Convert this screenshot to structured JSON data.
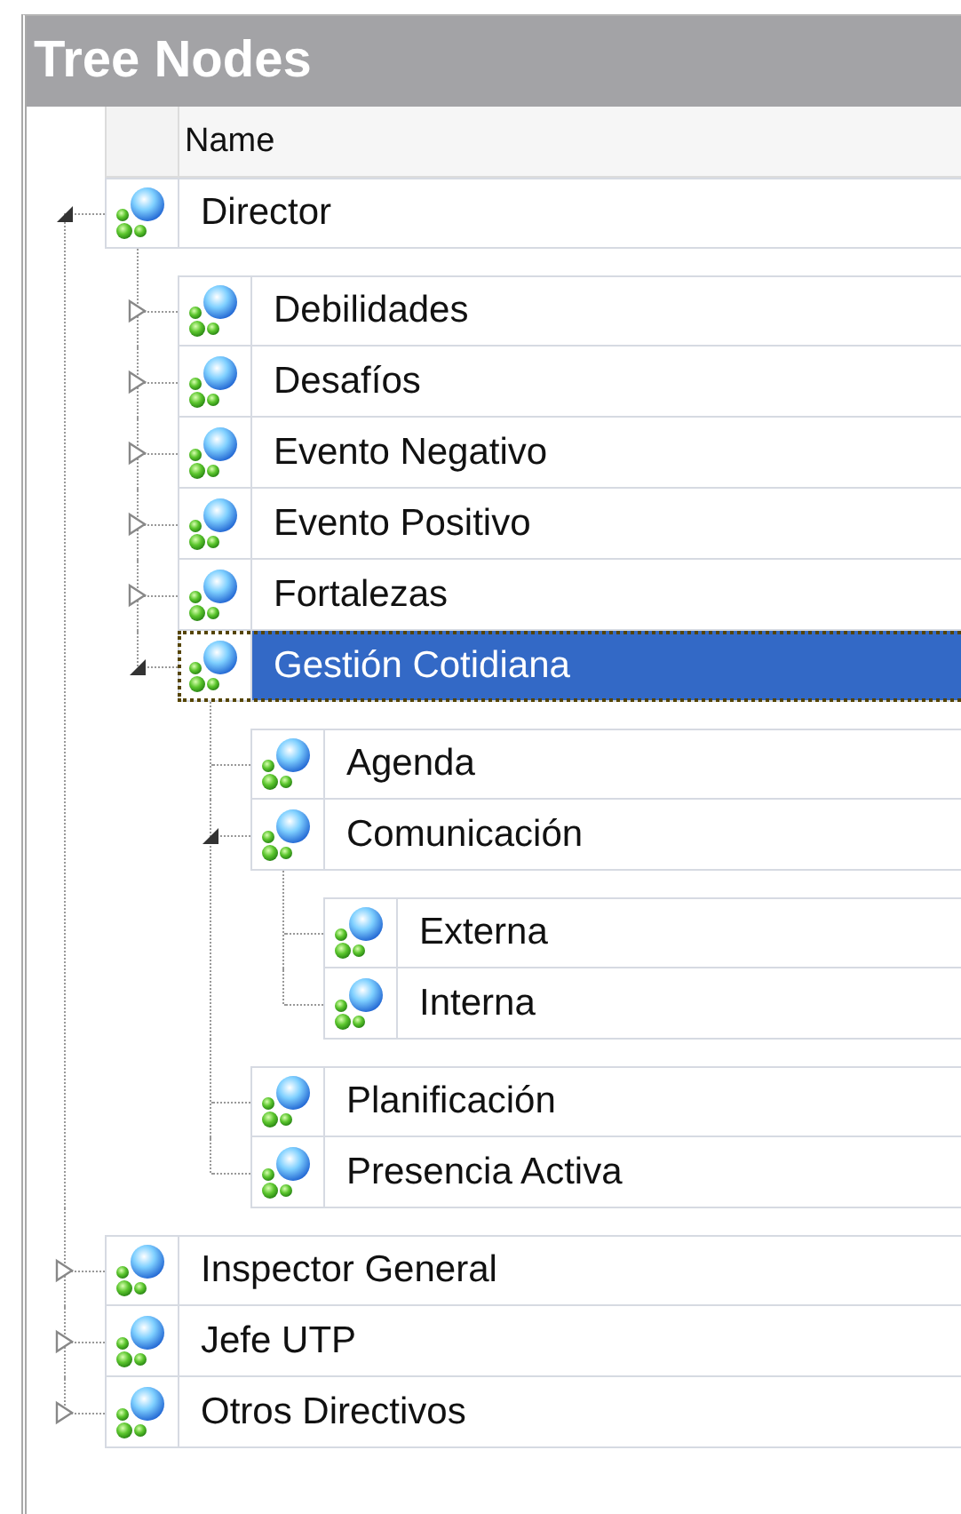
{
  "panel": {
    "title": "Tree Nodes"
  },
  "columns": [
    {
      "label": "Name"
    }
  ],
  "nodes": [
    {
      "label": "Director",
      "selected": false,
      "expanded": true,
      "children": [
        {
          "label": "Debilidades",
          "selected": false,
          "expanded": false
        },
        {
          "label": "Desafíos",
          "selected": false,
          "expanded": false
        },
        {
          "label": "Evento Negativo",
          "selected": false,
          "expanded": false
        },
        {
          "label": "Evento Positivo",
          "selected": false,
          "expanded": false
        },
        {
          "label": "Fortalezas",
          "selected": false,
          "expanded": false
        },
        {
          "label": "Gestión Cotidiana",
          "selected": true,
          "expanded": true,
          "children": [
            {
              "label": "Agenda",
              "selected": false
            },
            {
              "label": "Comunicación",
              "selected": false,
              "expanded": true,
              "children": [
                {
                  "label": "Externa",
                  "selected": false
                },
                {
                  "label": "Interna",
                  "selected": false
                }
              ]
            },
            {
              "label": "Planificación",
              "selected": false
            },
            {
              "label": "Presencia Activa",
              "selected": false
            }
          ]
        }
      ]
    },
    {
      "label": "Inspector General",
      "selected": false,
      "expanded": false
    },
    {
      "label": "Jefe UTP",
      "selected": false,
      "expanded": false
    },
    {
      "label": "Otros Directivos",
      "selected": false,
      "expanded": false
    }
  ]
}
